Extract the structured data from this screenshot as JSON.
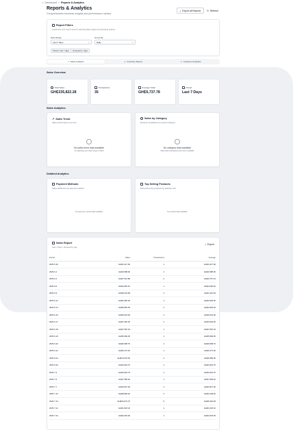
{
  "breadcrumb": {
    "home": "Dashboard",
    "separator": ">",
    "current": "Reports & Analytics"
  },
  "page": {
    "title": "Reports & Analytics",
    "subtitle": "Comprehensive business insights and performance metrics",
    "export_all_label": "Export all Reports",
    "refresh_label": "Refresh"
  },
  "filters": {
    "title": "Report Filters",
    "subtitle": "Customize your report view by selecting date ranges and grouping options",
    "date_range_label": "Date Range",
    "date_range_value": "Last 7 days",
    "group_by_label": "Group By",
    "group_by_value": "Daily",
    "chip_period": "Period: Last 7 days",
    "chip_grouped": "Grouped by: days"
  },
  "tabs": [
    {
      "label": "Sales Analytics",
      "active": true
    },
    {
      "label": "Inventory Report",
      "active": false
    },
    {
      "label": "Customer Analytics",
      "active": false
    }
  ],
  "sales_overview": {
    "title": "Sales Overview",
    "cards": [
      {
        "label": "Total Sales",
        "value": "GH₵235,822.28",
        "icon": "money-icon"
      },
      {
        "label": "Transactions",
        "value": "35",
        "icon": "receipt-icon"
      },
      {
        "label": "Average Order",
        "value": "GH₵6,737.78",
        "icon": "chart-icon"
      },
      {
        "label": "Period",
        "value": "Last 7 Days",
        "icon": "calendar-icon"
      }
    ]
  },
  "sales_analytics": {
    "title": "Sales Analytics",
    "trend": {
      "title": "Sales Trend",
      "subtitle": "Sales performance over time",
      "empty_title": "No sales trend data available",
      "empty_sub": "Try adjusting your date range or filters"
    },
    "category": {
      "title": "Sales by Category",
      "subtitle": "Revenue breakdown by product category",
      "empty_title": "No category data available",
      "empty_sub": "Sales data will appear here when available"
    }
  },
  "detailed_analytics": {
    "title": "Detailed Analytics",
    "payment": {
      "title": "Payment Methods",
      "subtitle": "Sales distribution by payment method",
      "empty": "No payment method data available"
    },
    "top_products": {
      "title": "Top Selling Products",
      "subtitle": "Best performing products by quantity sold",
      "empty": "No product data available"
    }
  },
  "sales_report": {
    "title": "Sales Report",
    "subtitle": "Last 7 days • Grouped by day",
    "export_label": "Export",
    "columns": [
      "Period",
      "Sales",
      "Transactions",
      "Average"
    ],
    "rows": [
      [
        "2025-5-30",
        "GH₵3,417.84",
        "1",
        "GH₵3,417.84"
      ],
      [
        "2025-6-1",
        "GH₵3,588.00",
        "1",
        "GH₵3,588.00"
      ],
      [
        "2025-6-4",
        "GH₵7,514.88",
        "2",
        "GH₵3,757.44"
      ],
      [
        "2025-6-6",
        "GH₵4,084.52",
        "1",
        "GH₵4,084.52"
      ],
      [
        "2025-6-9",
        "GH₵8,233.68",
        "2",
        "GH₵4,116.84"
      ],
      [
        "2025-6-12",
        "GH₵2,900.00",
        "1",
        "GH₵2,900.00"
      ],
      [
        "2025-6-13",
        "GH₵5,800.00",
        "2",
        "GH₵2,900.00"
      ],
      [
        "2025-6-15",
        "GH₵6,034.00",
        "1",
        "GH₵6,034.00"
      ],
      [
        "2025-6-17",
        "GH₵7,000.00",
        "2",
        "GH₵3,500.00"
      ],
      [
        "2025-6-18",
        "GH₵7,587.04",
        "1",
        "GH₵7,587.04"
      ],
      [
        "2025-6-19",
        "GH₵5,999.00",
        "1",
        "GH₵5,999.00"
      ],
      [
        "2025-6-20",
        "GH₵6,598.76",
        "1",
        "GH₵6,598.76"
      ],
      [
        "2025-6-22",
        "GH₵6,473.00",
        "1",
        "GH₵6,473.00"
      ],
      [
        "2025-6-24",
        "GH₵13,978.00",
        "2",
        "GH₵6,989.00"
      ],
      [
        "2025-6-26",
        "GH₵3,504.75",
        "1",
        "GH₵3,504.75"
      ],
      [
        "2025-7-4",
        "GH₵3,504.75",
        "1",
        "GH₵3,504.75"
      ],
      [
        "2025-7-5",
        "GH₵7,584.92",
        "1",
        "GH₵7,584.92"
      ],
      [
        "2025-7-7",
        "GH₵3,847.00",
        "1",
        "GH₵3,847.00"
      ],
      [
        "2025-7-15",
        "GH₵8,896.40",
        "2",
        "GH₵4,448.20"
      ],
      [
        "2025-7-16",
        "GH₵26,974.75",
        "5",
        "GH₵5,394.95"
      ],
      [
        "2025-7-21",
        "GH₵1,618.10",
        "1",
        "GH₵1,618.10"
      ],
      [
        "2025-7-23",
        "GH₵2,018.00",
        "1",
        "GH₵2,018.00"
      ]
    ]
  }
}
